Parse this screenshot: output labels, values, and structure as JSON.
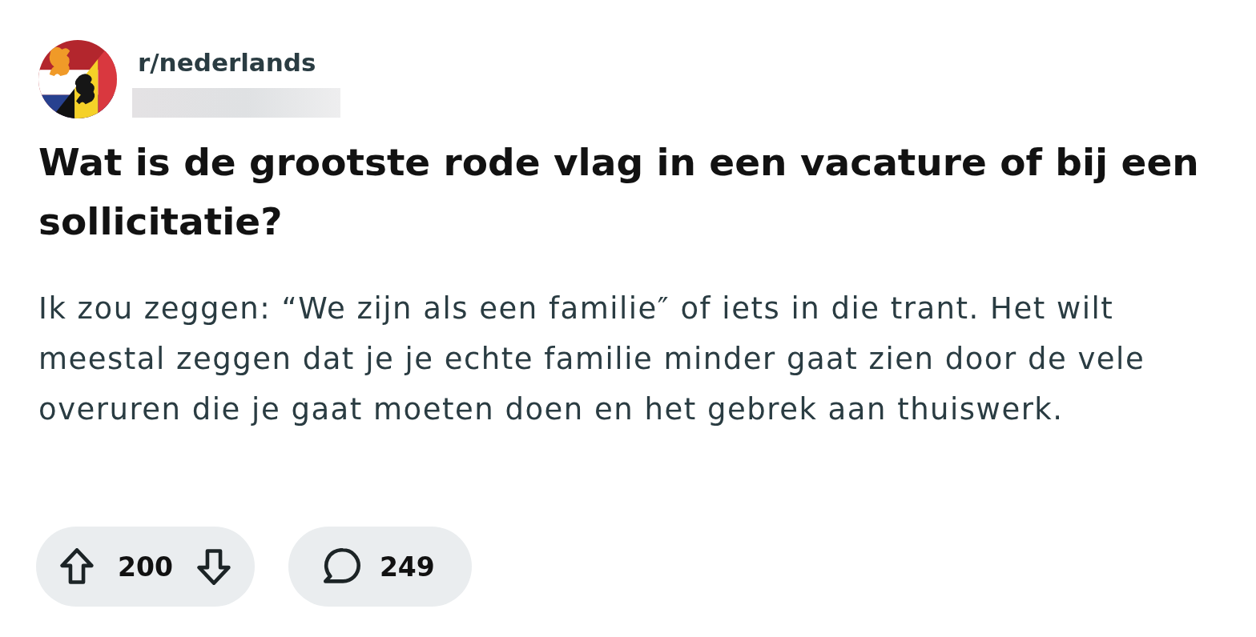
{
  "post": {
    "subreddit": "r/nederlands",
    "author_blurred": true,
    "title": "Wat is de grootste rode vlag in een vacature of bij een sollicitatie?",
    "body": "Ik zou zeggen: “We zijn als een familie″ of iets in die trant. Het wilt meestal zeggen dat je je echte familie minder gaat zien door de vele overuren die je gaat moeten doen en het gebrek aan thuiswerk."
  },
  "actions": {
    "score": "200",
    "comments": "249"
  }
}
